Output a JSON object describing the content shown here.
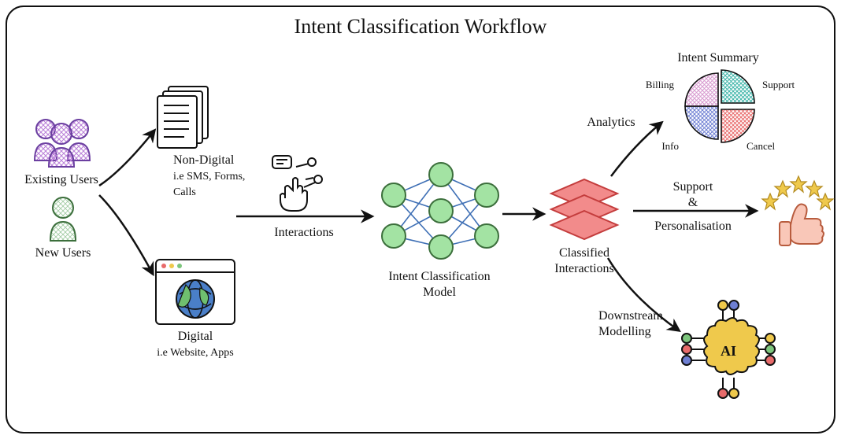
{
  "title": "Intent Classification Workflow",
  "existing_users": "Existing Users",
  "new_users": "New Users",
  "non_digital_l1": "Non-Digital",
  "non_digital_l2": "i.e SMS, Forms,",
  "non_digital_l3": "Calls",
  "digital_l1": "Digital",
  "digital_l2": "i.e Website, Apps",
  "interactions": "Interactions",
  "model_l1": "Intent Classification",
  "model_l2": "Model",
  "classified_l1": "Classified",
  "classified_l2": "Interactions",
  "analytics": "Analytics",
  "downstream_l1": "Downstream",
  "downstream_l2": "Modelling",
  "support_l1": "Support",
  "support_l2": "&",
  "support_l3": "Personalisation",
  "summary_title": "Intent Summary",
  "pie_billing": "Billing",
  "pie_support": "Support",
  "pie_info": "Info",
  "pie_cancel": "Cancel"
}
